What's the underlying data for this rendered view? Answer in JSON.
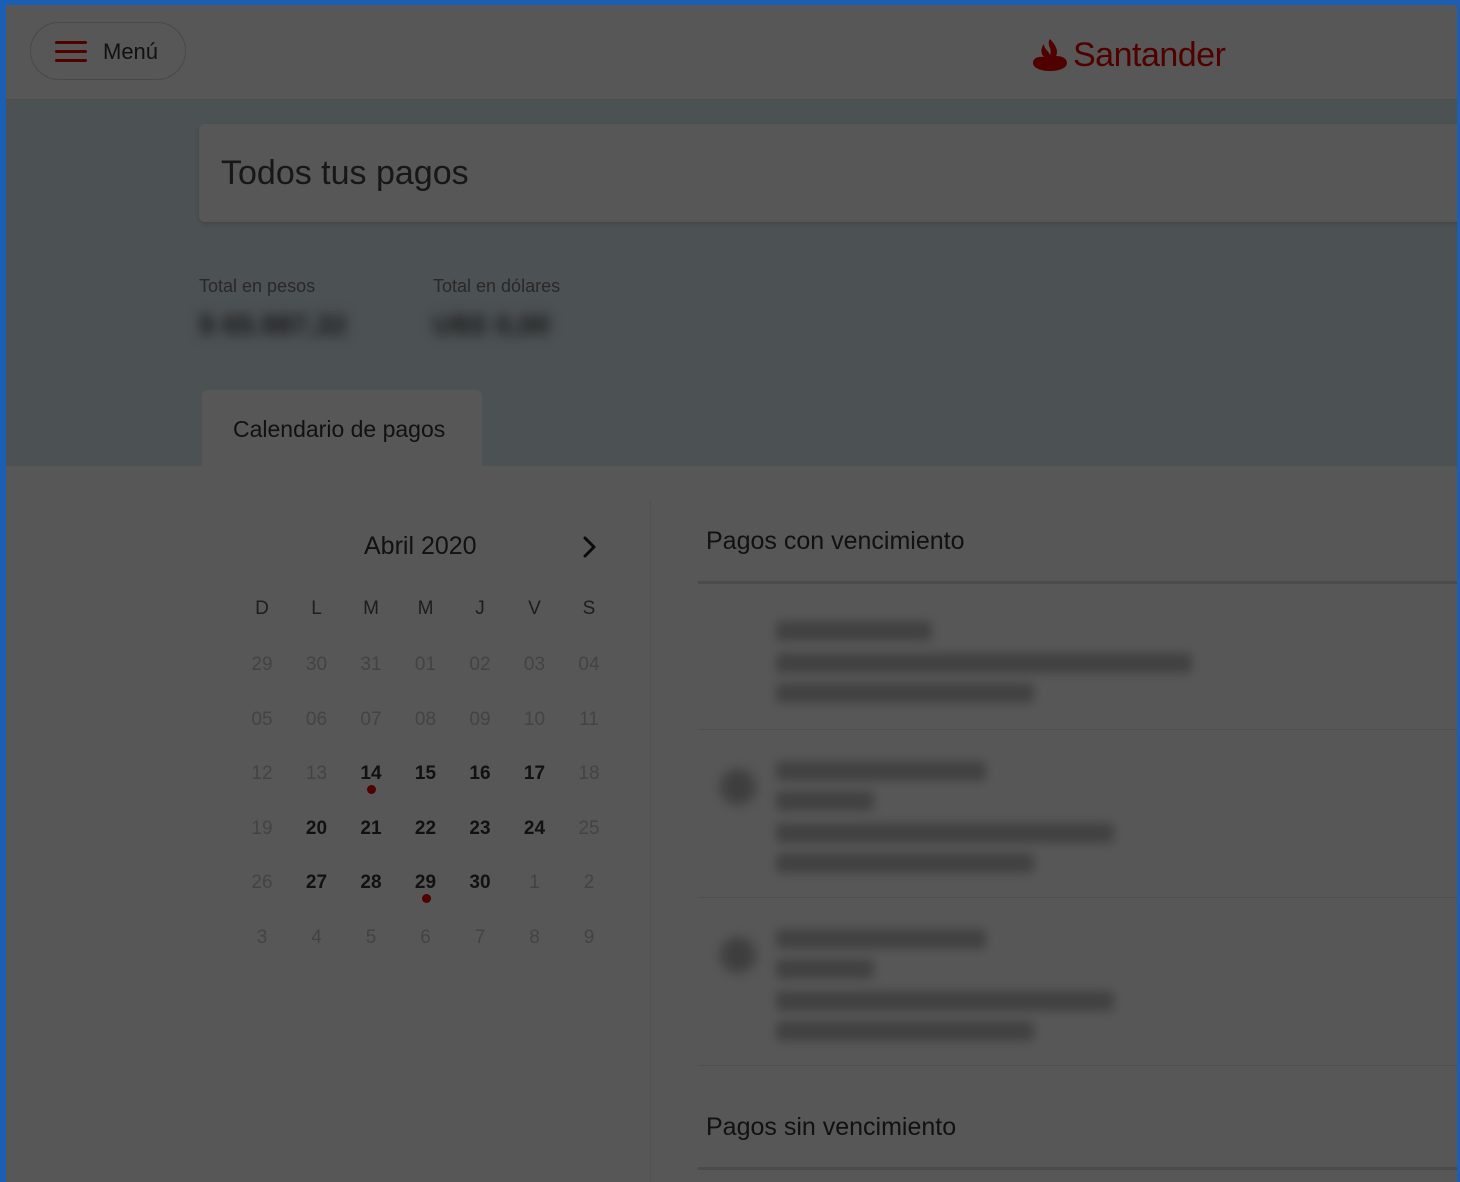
{
  "header": {
    "menu_label": "Menú",
    "brand": "Santander",
    "brand_color": "#ec0000"
  },
  "page": {
    "title": "Todos tus pagos",
    "totals": [
      {
        "label": "Total en pesos",
        "value": "$ 65.987,32"
      },
      {
        "label": "Total en dólares",
        "value": "U$S 0,00"
      }
    ],
    "tab_label": "Calendario de pagos"
  },
  "calendar": {
    "month_label": "Abril 2020",
    "next_icon": "chevron-right-icon",
    "weekdays": [
      "D",
      "L",
      "M",
      "M",
      "J",
      "V",
      "S"
    ],
    "weeks": [
      [
        "29",
        "30",
        "31",
        "01",
        "02",
        "03",
        "04"
      ],
      [
        "05",
        "06",
        "07",
        "08",
        "09",
        "10",
        "11"
      ],
      [
        "12",
        "13",
        "14",
        "15",
        "16",
        "17",
        "18"
      ],
      [
        "19",
        "20",
        "21",
        "22",
        "23",
        "24",
        "25"
      ],
      [
        "26",
        "27",
        "28",
        "29",
        "30",
        "1",
        "2"
      ],
      [
        "3",
        "4",
        "5",
        "6",
        "7",
        "8",
        "9"
      ]
    ],
    "selected_day": "14",
    "days_with_payments": [
      "14",
      "29"
    ]
  },
  "payments": {
    "with_due_title": "Pagos con vencimiento",
    "without_due_title": "Pagos sin vencimiento"
  },
  "overlay_active": true
}
